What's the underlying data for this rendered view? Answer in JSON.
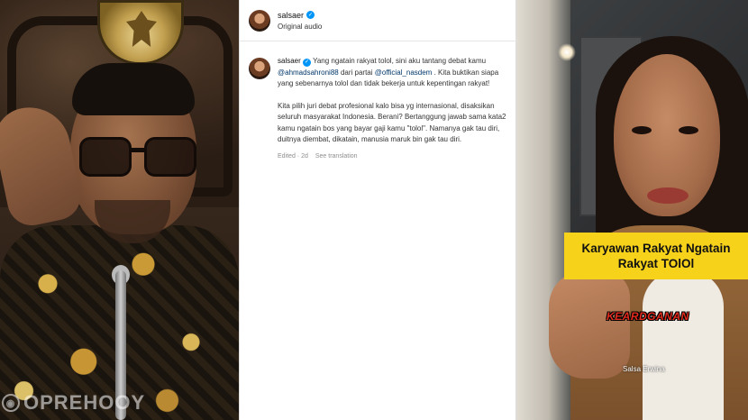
{
  "left": {
    "watermark": "OPREHOOY"
  },
  "post": {
    "username": "salsaer",
    "audio": "Original audio",
    "caption": {
      "username": "salsaer",
      "line1_pre": "Yang ngatain rakyat tolol, sini aku tantang debat kamu",
      "mention1": "@ahmadsahroni88",
      "line1_mid": "dari partai",
      "mention2": "@official_nasdem",
      "line1_post": ". Kita buktikan siapa yang sebenarnya tolol dan tidak bekerja untuk kepentingan rakyat!",
      "para2": "Kita pilih juri debat profesional kalo bisa yg internasional, disaksikan seluruh masyarakat Indonesia. Berani? Bertanggung jawab sama kata2 kamu ngatain bos yang bayar gaji kamu \"tolol\". Namanya gak tau diri, duitnya diembat, dikatain, manusia maruk bin gak tau diri."
    },
    "meta": {
      "edited": "Edited · 2d",
      "translation": "See translation"
    }
  },
  "video": {
    "label_line1": "Karyawan Rakyat Ngatain",
    "label_line2": "Rakyat TOlOl",
    "red_text": "KEARDGANAN",
    "name_tag": "Salsa Erwina"
  },
  "colors": {
    "label_bg": "#f7d21b",
    "red_text": "#e52a1e",
    "mention": "#00376b",
    "verified": "#0095f6"
  }
}
